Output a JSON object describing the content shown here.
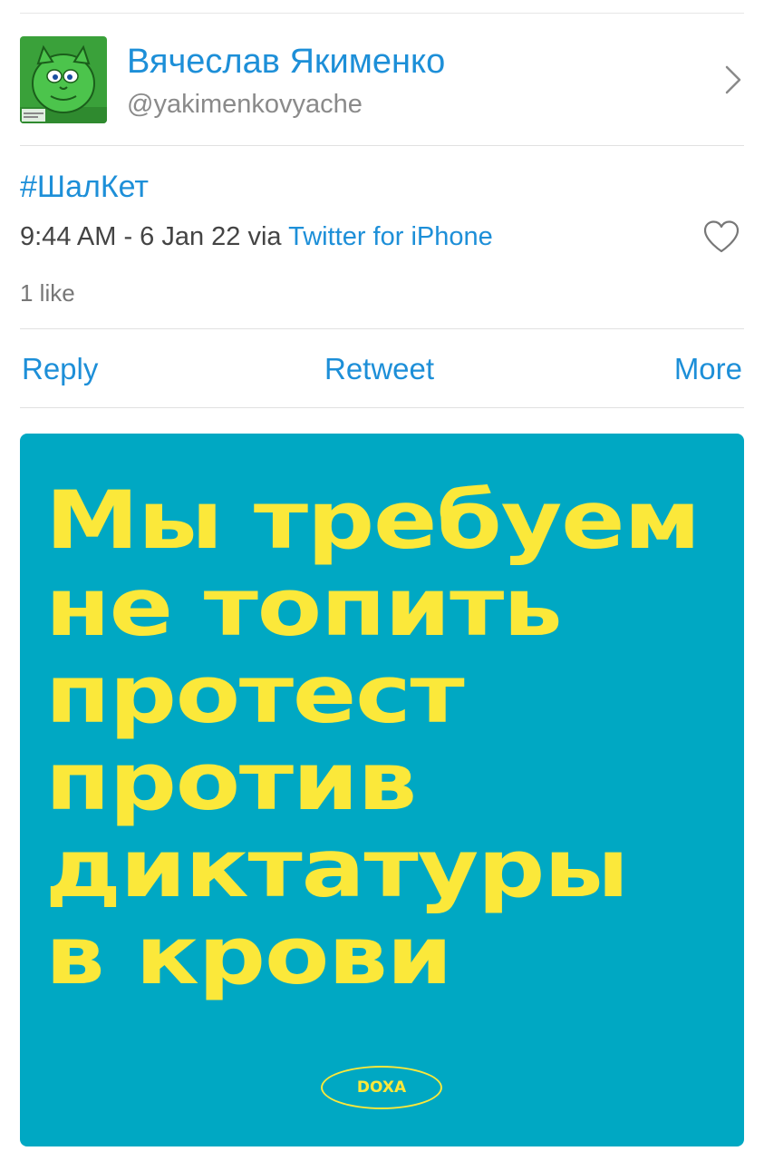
{
  "author": {
    "display_name": "Вячеслав Якименко",
    "handle": "@yakimenkovyache",
    "avatar_icon": "green-cartoon-cat-avatar",
    "chevron_icon": "chevron-right-icon"
  },
  "tweet": {
    "hashtag": "#ШалКет",
    "timestamp": "9:44 AM - 6 Jan 22 via ",
    "source": "Twitter for iPhone",
    "like_icon": "heart-icon",
    "likes": "1 like"
  },
  "actions": {
    "reply": "Reply",
    "retweet": "Retweet",
    "more": "More"
  },
  "media": {
    "lines": [
      "Мы требуем",
      "не топить",
      "протест",
      "против",
      "диктатуры",
      "в крови"
    ],
    "logo_text": "DOXA",
    "background_color": "#00a8c3",
    "text_color": "#fbe83a"
  },
  "colors": {
    "link": "#1d8fd8",
    "muted": "#8a8a8a"
  }
}
